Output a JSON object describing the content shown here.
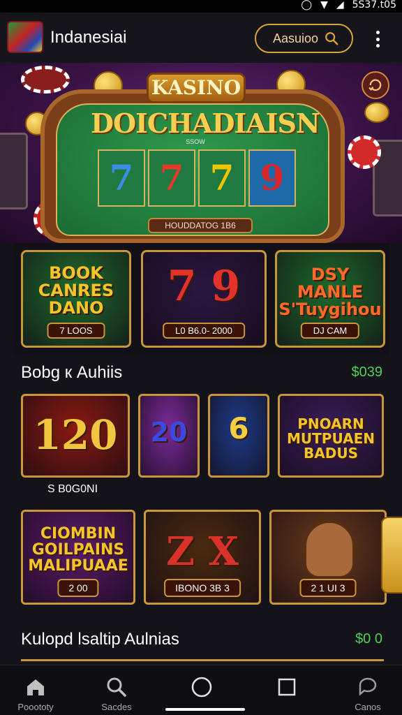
{
  "status_bar": {
    "time": "5S37.t05"
  },
  "header": {
    "app_title": "Indanesiai",
    "search_label": "Aasuioo"
  },
  "hero": {
    "brand_badge": "KASINO",
    "headline": "DOICHADIAISN",
    "subline": "SSOW",
    "reels": [
      "7",
      "7",
      "7",
      "9"
    ],
    "reel_colors": [
      "#3a8ee8",
      "#e23a2a",
      "#f2c400",
      "#d8262a"
    ],
    "plaque": "HOUDDATOG 1B6"
  },
  "banners": [
    {
      "title": "BOOK\nCANRES\nDANO",
      "caption": "7 LOOS",
      "bg": "#1e6b2e",
      "color": "#f4c52a"
    },
    {
      "title": "7  9",
      "caption": "L0 B6.0- 2000",
      "bg": "#2a1740",
      "color": "#e2332a"
    },
    {
      "title": "DSY\nMANLE\nS'Tuygihou",
      "caption": "DJ CAM",
      "bg": "#1c6a2a",
      "color": "#ff6a2a"
    }
  ],
  "section1": {
    "title": "Bobg к Auhiis",
    "amount": "$039"
  },
  "row1": [
    {
      "title": "120",
      "caption": "",
      "bg": "#8a1a10",
      "color": "#f3c640"
    },
    {
      "title": "20",
      "caption": "",
      "bg": "#7a2a9a",
      "color": "#3a4ae0"
    },
    {
      "title": "6",
      "caption": "",
      "bg": "#1d3c8a",
      "color": "#f2d040"
    },
    {
      "title": "PNOARN\nMUTPUAEN\nBADUS",
      "caption": "",
      "bg": "#3a1d5a",
      "color": "#f4c52a"
    }
  ],
  "row1_caption": "S B0G0NI",
  "row2": [
    {
      "title": "CIOMBIN\nGOILPAINS\nMALIPUAAE",
      "caption": "2 00",
      "bg": "#5a1a6a",
      "color": "#f4c52a"
    },
    {
      "title": "Z  X",
      "caption": "IBONO 3B 3",
      "bg": "#4a2a10",
      "color": "#d8322a"
    },
    {
      "title": "",
      "caption": "2 1 UI 3",
      "bg": "#6a3a1a",
      "color": "#f4c52a"
    }
  ],
  "section2": {
    "title": "Kulopd lsaltip Aulnias",
    "amount": "$0 0"
  },
  "nav": [
    {
      "label": "Pooototy",
      "icon": "home-icon"
    },
    {
      "label": "Sacdes",
      "icon": "search-icon"
    },
    {
      "label": "",
      "icon": "circle-icon"
    },
    {
      "label": "",
      "icon": "square-icon"
    },
    {
      "label": "Canos",
      "icon": "chat-icon"
    }
  ]
}
